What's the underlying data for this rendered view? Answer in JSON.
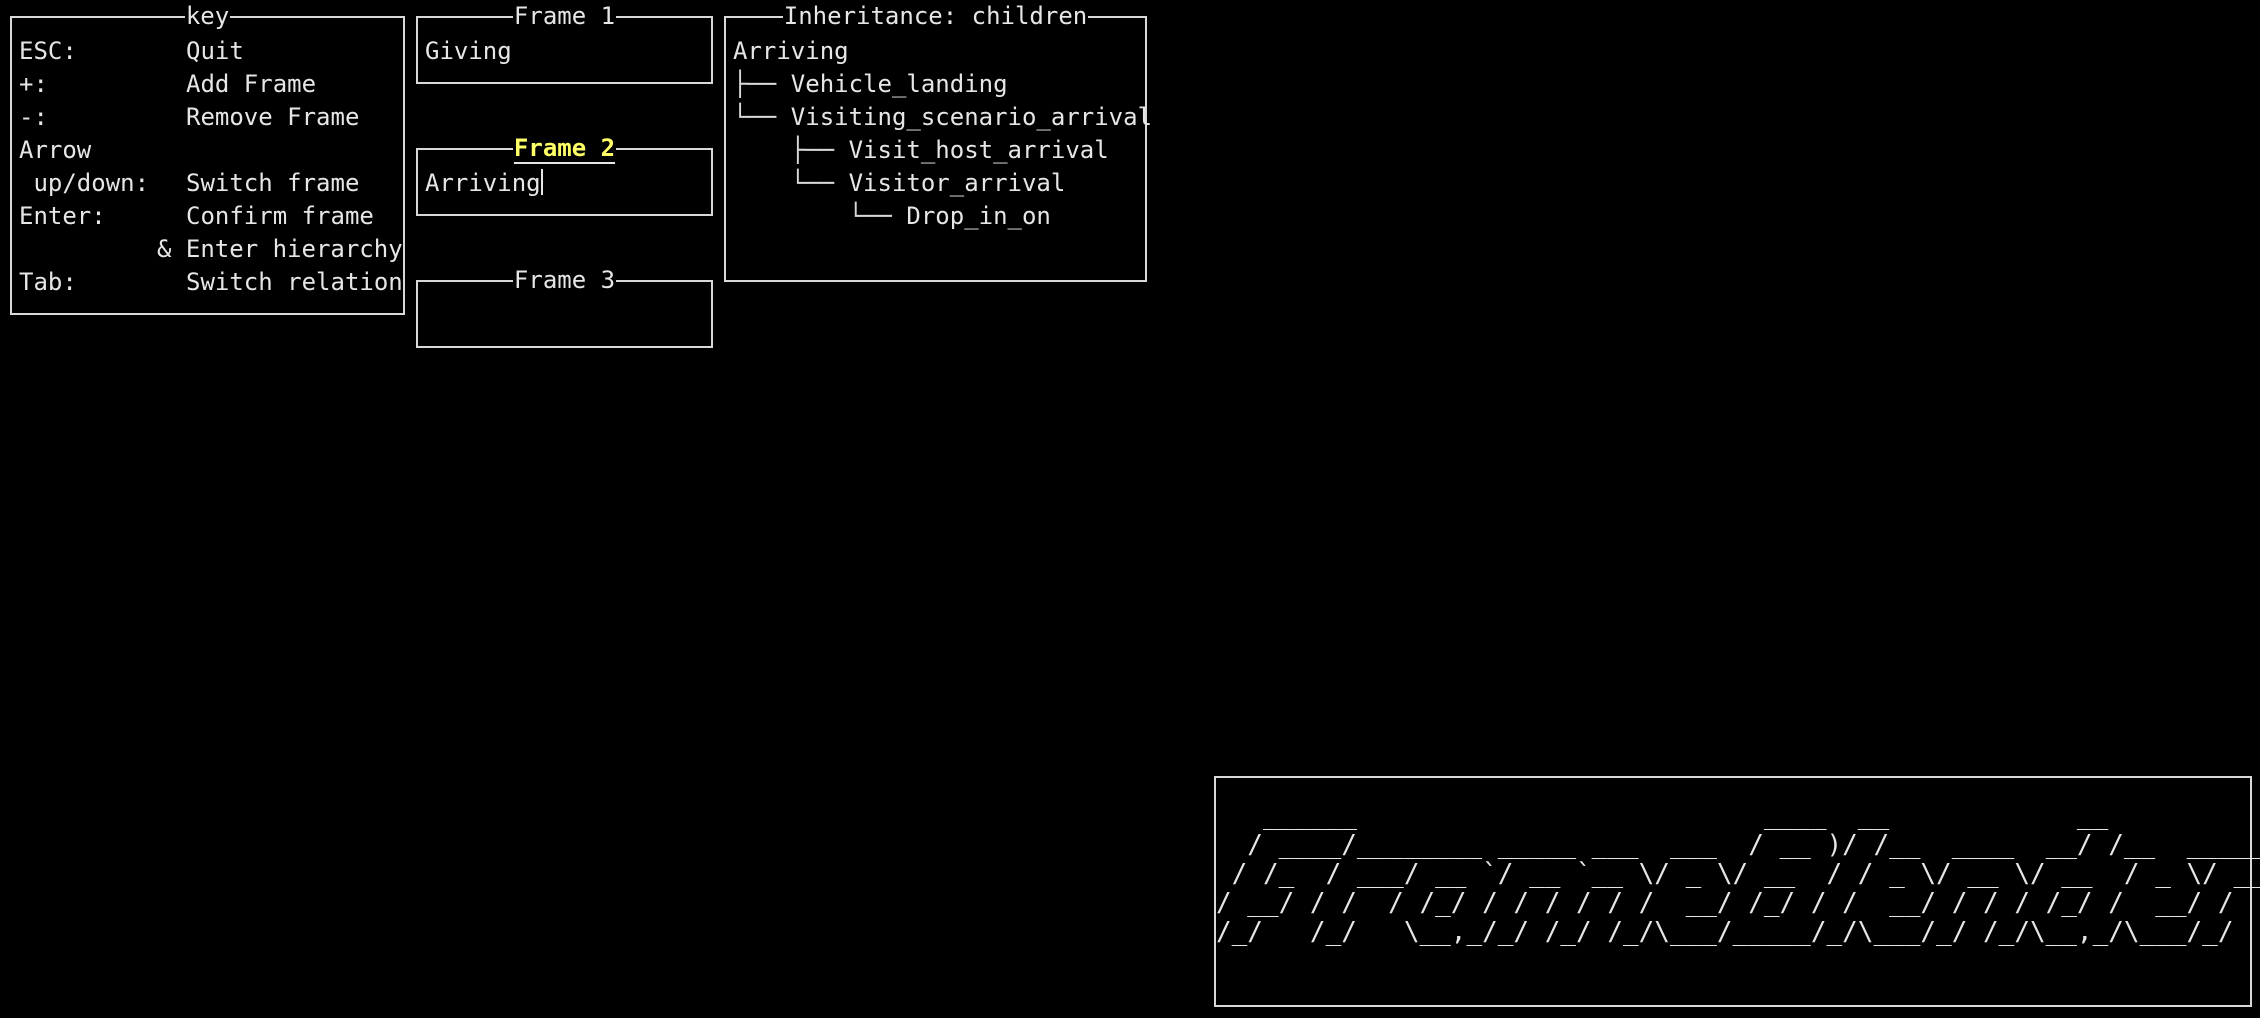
{
  "key_panel": {
    "title": "key",
    "rows": [
      {
        "k": "ESC:",
        "v": "Quit"
      },
      {
        "k": "+:",
        "v": "Add Frame"
      },
      {
        "k": "-:",
        "v": "Remove Frame"
      },
      {
        "k": "Arrow",
        "v": ""
      },
      {
        "k": " up/down:",
        "v": "Switch frame"
      },
      {
        "k": "Enter:",
        "v": "Confirm frame"
      },
      {
        "k": "",
        "v": "& Enter hierarchy"
      },
      {
        "k": "Tab:",
        "v": "Switch relation"
      }
    ]
  },
  "frames": [
    {
      "title": "Frame 1",
      "value": "Giving",
      "active": false
    },
    {
      "title": "Frame 2",
      "value": "Arriving",
      "active": true
    },
    {
      "title": "Frame 3",
      "value": "",
      "active": false
    }
  ],
  "hierarchy": {
    "title": "Inheritance: children",
    "root": "Arriving",
    "nodes": [
      {
        "guide": "├── ",
        "label": "Vehicle_landing"
      },
      {
        "guide": "└── ",
        "label": "Visiting_scenario_arrival"
      },
      {
        "guide": "    ├── ",
        "label": "Visit_host_arrival"
      },
      {
        "guide": "    └── ",
        "label": "Visitor_arrival"
      },
      {
        "guide": "        └── ",
        "label": "Drop_in_on"
      }
    ]
  },
  "banner": {
    "lines": [
      "   ______                          ____  __            __",
      "  / ____/________ _____ ___  ___  / __ )/ /__  ____  __/ /__  _____",
      " / /_  / ___/ __ `/ __ `__ \\/ _ \\/ __  / / _ \\/ __ \\/ __  / _ \\/ ___/",
      "/ __/ / /  / /_/ / / / / / /  __/ /_/ / /  __/ / / / /_/ /  __/ /",
      "/_/   /_/   \\__,_/_/ /_/ /_/\\___/_____/_/\\___/_/ /_/\\__,_/\\___/_/"
    ]
  }
}
